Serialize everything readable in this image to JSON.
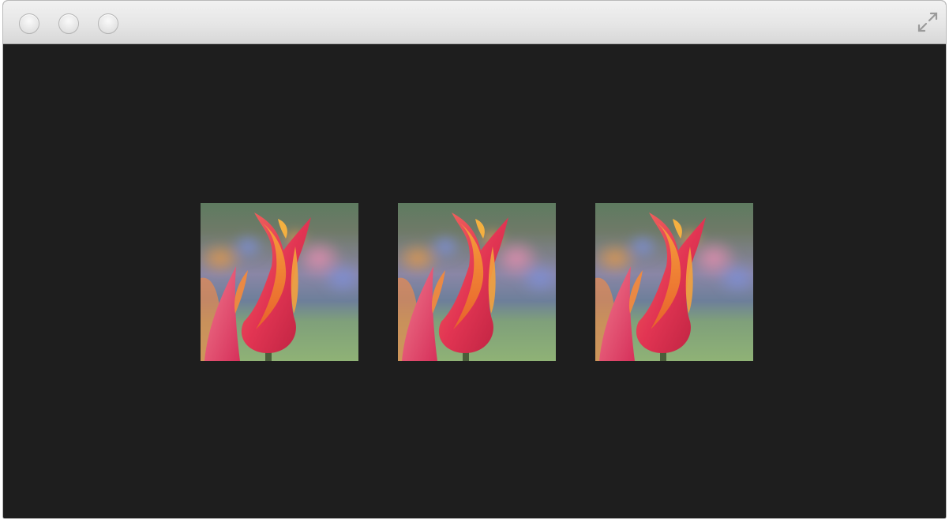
{
  "window": {
    "chrome_color": "#e6e6e6",
    "background_color": "#1e1e1e",
    "title_buttons": [
      {
        "name": "close",
        "icon": "circle-button-icon"
      },
      {
        "name": "minimize",
        "icon": "circle-button-icon"
      },
      {
        "name": "zoom",
        "icon": "circle-button-icon"
      }
    ],
    "fullscreen_icon": "fullscreen-arrows-icon"
  },
  "gallery": {
    "images": [
      {
        "subject": "tulip",
        "colors": [
          "#e8364f",
          "#f08a2a"
        ]
      },
      {
        "subject": "tulip",
        "colors": [
          "#e8364f",
          "#f08a2a"
        ]
      },
      {
        "subject": "tulip",
        "colors": [
          "#e8364f",
          "#f08a2a"
        ]
      }
    ]
  }
}
